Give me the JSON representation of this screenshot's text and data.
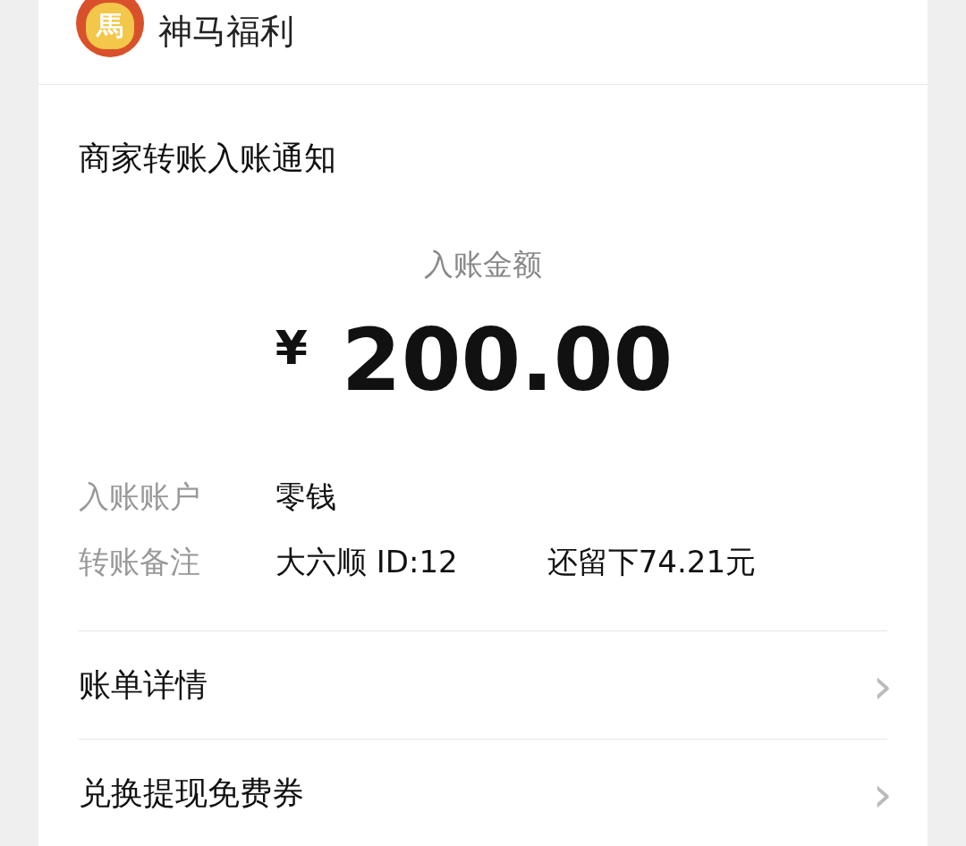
{
  "account": {
    "logo_glyph": "馬",
    "name": "神马福利"
  },
  "notice": {
    "title": "商家转账入账通知",
    "amount_label": "入账金额",
    "currency": "¥",
    "amount": "200.00",
    "details": [
      {
        "label": "入账账户",
        "values": [
          "零钱"
        ]
      },
      {
        "label": "转账备注",
        "values": [
          "大六顺 ID:12",
          "还留下74.21元"
        ]
      }
    ]
  },
  "menu": [
    {
      "label": "账单详情",
      "chevron": "›"
    },
    {
      "label": "兑换提现免费券",
      "chevron": "›"
    }
  ]
}
